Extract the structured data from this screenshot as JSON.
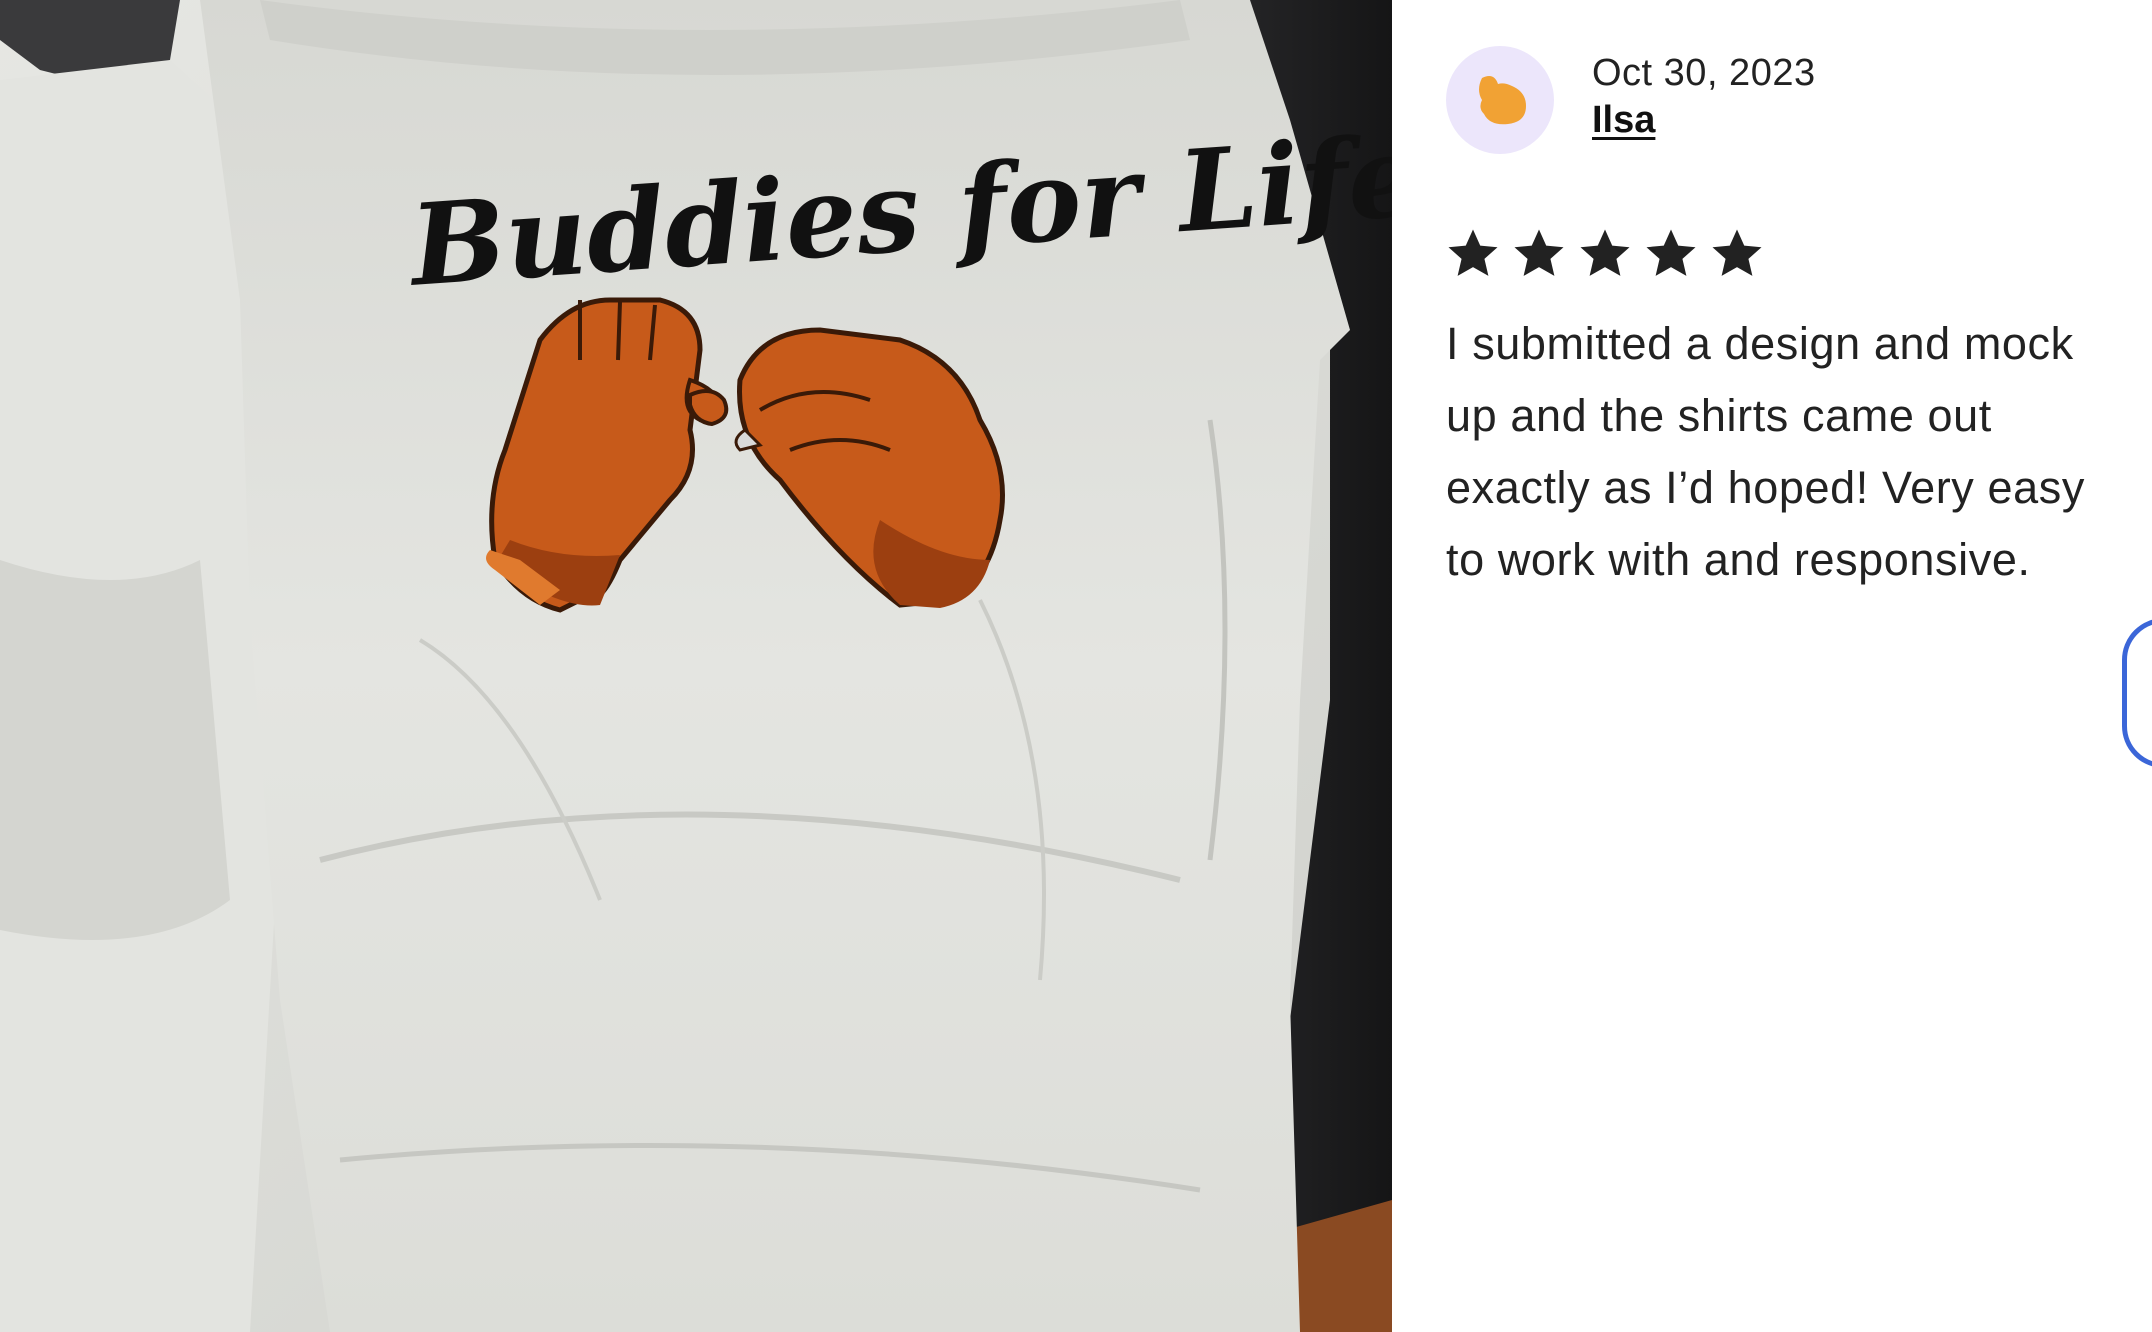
{
  "photo": {
    "shirt_print_text": "Buddies for Life",
    "alt_description_icon": "tshirt-photo"
  },
  "review": {
    "date": "Oct 30, 2023",
    "reviewer_name": "Ilsa",
    "rating": 5,
    "rating_max": 5,
    "text": "I submitted a design and mock up and the shirts came out exactly as I’d hoped! Very easy to work with and responsive.",
    "avatar_icon": "default-avatar-icon",
    "star_icon": "star-filled-icon"
  },
  "colors": {
    "star": "#222222",
    "avatar_bg": "#ece6fb",
    "avatar_fg": "#f1a234",
    "edge_button_border": "#3b66d8",
    "hand_primary": "#c75a1a",
    "hand_shadow": "#9c3f10"
  }
}
